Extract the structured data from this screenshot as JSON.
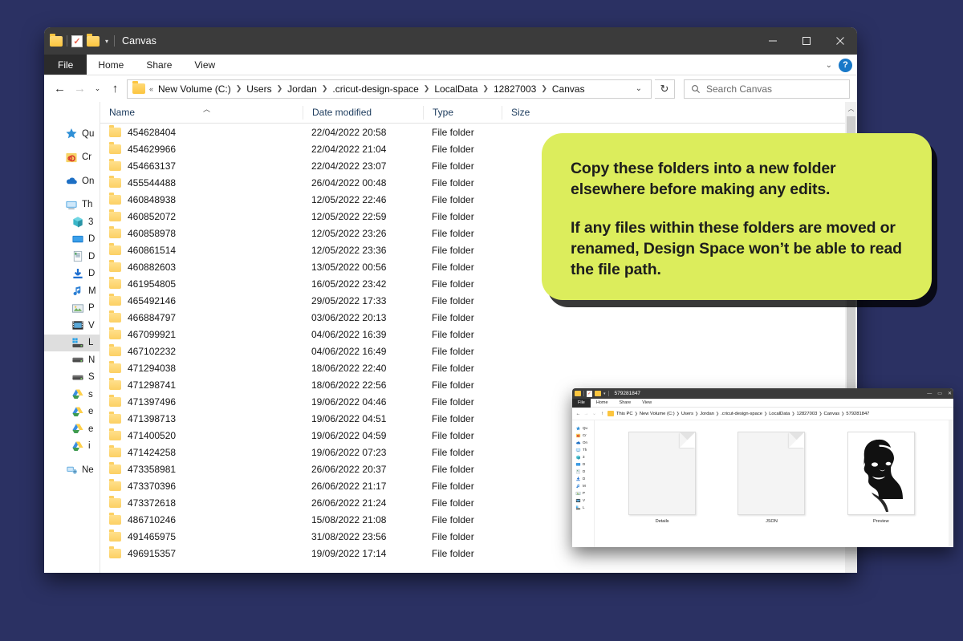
{
  "background_color": "#2b3163",
  "explorer": {
    "titlebar": {
      "title": "Canvas",
      "quick_access": [
        "folder-icon",
        "properties-doc-icon",
        "new-folder-icon",
        "customize-caret-icon"
      ],
      "minimize_label": "Minimize",
      "maximize_label": "Maximize",
      "close_label": "Close"
    },
    "ribbon": {
      "tabs": [
        "File",
        "Home",
        "Share",
        "View"
      ],
      "collapse_label": "Collapse the Ribbon",
      "help_label": "?"
    },
    "address": {
      "back_label": "Back",
      "forward_label": "Forward",
      "recent_label": "Recent locations",
      "up_label": "Up",
      "overflow": "«",
      "crumbs": [
        "New Volume (C:)",
        "Users",
        "Jordan",
        ".cricut-design-space",
        "LocalData",
        "12827003",
        "Canvas"
      ],
      "dropdown_label": "Previous locations",
      "refresh_label": "Refresh"
    },
    "search": {
      "placeholder": "Search Canvas",
      "icon": "search-icon"
    },
    "nav_pane": {
      "items": [
        {
          "label": "Qu",
          "icon": "quick-access-star-icon",
          "selected": false,
          "indent": false
        },
        {
          "label": "Cr",
          "icon": "creative-cloud-icon",
          "selected": false,
          "indent": false
        },
        {
          "label": "On",
          "icon": "onedrive-cloud-icon",
          "selected": false,
          "indent": false
        },
        {
          "label": "Th",
          "icon": "this-pc-icon",
          "selected": false,
          "indent": false
        },
        {
          "label": "3",
          "icon": "3d-objects-icon",
          "selected": false,
          "indent": true
        },
        {
          "label": "D",
          "icon": "desktop-icon",
          "selected": false,
          "indent": true
        },
        {
          "label": "D",
          "icon": "documents-icon",
          "selected": false,
          "indent": true
        },
        {
          "label": "D",
          "icon": "downloads-icon",
          "selected": false,
          "indent": true
        },
        {
          "label": "M",
          "icon": "music-icon",
          "selected": false,
          "indent": true
        },
        {
          "label": "P",
          "icon": "pictures-icon",
          "selected": false,
          "indent": true
        },
        {
          "label": "V",
          "icon": "videos-icon",
          "selected": false,
          "indent": true
        },
        {
          "label": "L",
          "icon": "windows-drive-icon",
          "selected": true,
          "indent": true
        },
        {
          "label": "N",
          "icon": "local-disk-icon",
          "selected": false,
          "indent": true
        },
        {
          "label": "S",
          "icon": "local-disk-icon",
          "selected": false,
          "indent": true
        },
        {
          "label": "s",
          "icon": "google-drive-icon",
          "selected": false,
          "indent": true
        },
        {
          "label": "e",
          "icon": "google-drive-icon",
          "selected": false,
          "indent": true
        },
        {
          "label": "e",
          "icon": "google-drive-icon",
          "selected": false,
          "indent": true
        },
        {
          "label": "i",
          "icon": "google-drive-icon",
          "selected": false,
          "indent": true
        },
        {
          "label": "Ne",
          "icon": "network-icon",
          "selected": false,
          "indent": false
        }
      ]
    },
    "columns": [
      "Name",
      "Date modified",
      "Type",
      "Size"
    ],
    "sort": {
      "column": "Name",
      "direction": "ascending",
      "icon": "sort-ascending-caret-icon"
    },
    "rows": [
      {
        "name": "454628404",
        "date": "22/04/2022 20:58",
        "type": "File folder",
        "size": ""
      },
      {
        "name": "454629966",
        "date": "22/04/2022 21:04",
        "type": "File folder",
        "size": ""
      },
      {
        "name": "454663137",
        "date": "22/04/2022 23:07",
        "type": "File folder",
        "size": ""
      },
      {
        "name": "455544488",
        "date": "26/04/2022 00:48",
        "type": "File folder",
        "size": ""
      },
      {
        "name": "460848938",
        "date": "12/05/2022 22:46",
        "type": "File folder",
        "size": ""
      },
      {
        "name": "460852072",
        "date": "12/05/2022 22:59",
        "type": "File folder",
        "size": ""
      },
      {
        "name": "460858978",
        "date": "12/05/2022 23:26",
        "type": "File folder",
        "size": ""
      },
      {
        "name": "460861514",
        "date": "12/05/2022 23:36",
        "type": "File folder",
        "size": ""
      },
      {
        "name": "460882603",
        "date": "13/05/2022 00:56",
        "type": "File folder",
        "size": ""
      },
      {
        "name": "461954805",
        "date": "16/05/2022 23:42",
        "type": "File folder",
        "size": ""
      },
      {
        "name": "465492146",
        "date": "29/05/2022 17:33",
        "type": "File folder",
        "size": ""
      },
      {
        "name": "466884797",
        "date": "03/06/2022 20:13",
        "type": "File folder",
        "size": ""
      },
      {
        "name": "467099921",
        "date": "04/06/2022 16:39",
        "type": "File folder",
        "size": ""
      },
      {
        "name": "467102232",
        "date": "04/06/2022 16:49",
        "type": "File folder",
        "size": ""
      },
      {
        "name": "471294038",
        "date": "18/06/2022 22:40",
        "type": "File folder",
        "size": ""
      },
      {
        "name": "471298741",
        "date": "18/06/2022 22:56",
        "type": "File folder",
        "size": ""
      },
      {
        "name": "471397496",
        "date": "19/06/2022 04:46",
        "type": "File folder",
        "size": ""
      },
      {
        "name": "471398713",
        "date": "19/06/2022 04:51",
        "type": "File folder",
        "size": ""
      },
      {
        "name": "471400520",
        "date": "19/06/2022 04:59",
        "type": "File folder",
        "size": ""
      },
      {
        "name": "471424258",
        "date": "19/06/2022 07:23",
        "type": "File folder",
        "size": ""
      },
      {
        "name": "473358981",
        "date": "26/06/2022 20:37",
        "type": "File folder",
        "size": ""
      },
      {
        "name": "473370396",
        "date": "26/06/2022 21:17",
        "type": "File folder",
        "size": ""
      },
      {
        "name": "473372618",
        "date": "26/06/2022 21:24",
        "type": "File folder",
        "size": ""
      },
      {
        "name": "486710246",
        "date": "15/08/2022 21:08",
        "type": "File folder",
        "size": ""
      },
      {
        "name": "491465975",
        "date": "31/08/2022 23:56",
        "type": "File folder",
        "size": ""
      },
      {
        "name": "496915357",
        "date": "19/09/2022 17:14",
        "type": "File folder",
        "size": ""
      }
    ]
  },
  "callout": {
    "color": "#dced5c",
    "paragraph1": "Copy these folders into a new folder elsewhere before making any edits.",
    "paragraph2": "If any files within these folders are moved or renamed, Design Space won’t be able to read the file path."
  },
  "nested_window": {
    "title": "579281847",
    "ribbon_tabs": [
      "File",
      "Home",
      "Share",
      "View"
    ],
    "crumbs": [
      "This PC",
      "New Volume (C:)",
      "Users",
      "Jordan",
      ".cricut-design-space",
      "LocalData",
      "12827003",
      "Canvas",
      "579281847"
    ],
    "nav_items": [
      {
        "label": "Qu",
        "icon": "quick-access-star-icon"
      },
      {
        "label": "Cr",
        "icon": "creative-cloud-icon"
      },
      {
        "label": "On",
        "icon": "onedrive-cloud-icon"
      },
      {
        "label": "Th",
        "icon": "this-pc-icon"
      },
      {
        "label": "3",
        "icon": "3d-objects-icon"
      },
      {
        "label": "D",
        "icon": "desktop-icon"
      },
      {
        "label": "D",
        "icon": "documents-icon"
      },
      {
        "label": "D",
        "icon": "downloads-icon"
      },
      {
        "label": "M",
        "icon": "music-icon"
      },
      {
        "label": "P",
        "icon": "pictures-icon"
      },
      {
        "label": "V",
        "icon": "videos-icon"
      },
      {
        "label": "L",
        "icon": "windows-drive-icon"
      }
    ],
    "items": [
      {
        "label": "Details",
        "icon": "blank-document-icon"
      },
      {
        "label": "JSON",
        "icon": "blank-document-icon"
      },
      {
        "label": "Preview",
        "icon": "portrait-preview-image"
      }
    ]
  }
}
